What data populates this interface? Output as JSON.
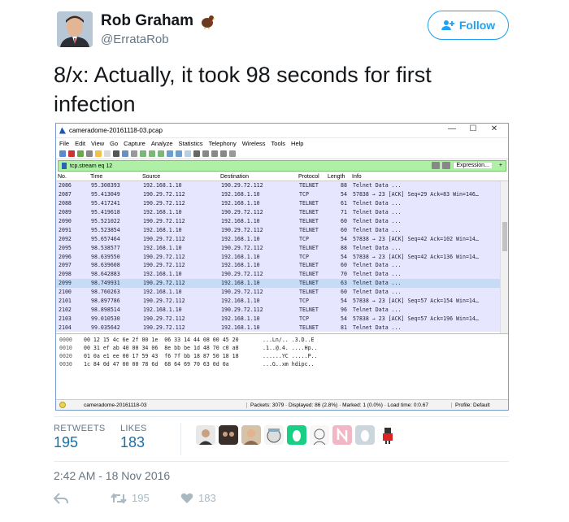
{
  "author": {
    "name": "Rob Graham",
    "handle": "@ErrataRob"
  },
  "follow_button": {
    "label": "Follow"
  },
  "tweet_text": "8/x: Actually, it took 98 seconds for first infection",
  "wireshark": {
    "window_title": "cameradome-20161118-03.pcap",
    "window_controls": [
      "—",
      "☐",
      "✕"
    ],
    "menu": [
      "File",
      "Edit",
      "View",
      "Go",
      "Capture",
      "Analyze",
      "Statistics",
      "Telephony",
      "Wireless",
      "Tools",
      "Help"
    ],
    "filter_value": "tcp.stream eq 12",
    "filter_expression_label": "Expression...",
    "filter_plus": "+",
    "columns": [
      "No.",
      "Time",
      "Source",
      "Destination",
      "Protocol",
      "Length",
      "Info"
    ],
    "rows": [
      {
        "no": "2086",
        "time": "95.308393",
        "src": "192.168.1.10",
        "dst": "190.29.72.112",
        "proto": "TELNET",
        "len": "88",
        "info": "Telnet Data ...",
        "selected": false
      },
      {
        "no": "2087",
        "time": "95.413049",
        "src": "190.29.72.112",
        "dst": "192.168.1.10",
        "proto": "TCP",
        "len": "54",
        "info": "57838 → 23 [ACK] Seq=29 Ack=83 Win=146…",
        "selected": false
      },
      {
        "no": "2088",
        "time": "95.417241",
        "src": "190.29.72.112",
        "dst": "192.168.1.10",
        "proto": "TELNET",
        "len": "61",
        "info": "Telnet Data ...",
        "selected": false
      },
      {
        "no": "2089",
        "time": "95.419618",
        "src": "192.168.1.10",
        "dst": "190.29.72.112",
        "proto": "TELNET",
        "len": "71",
        "info": "Telnet Data ...",
        "selected": false
      },
      {
        "no": "2090",
        "time": "95.521022",
        "src": "190.29.72.112",
        "dst": "192.168.1.10",
        "proto": "TELNET",
        "len": "60",
        "info": "Telnet Data ...",
        "selected": false
      },
      {
        "no": "2091",
        "time": "95.523854",
        "src": "192.168.1.10",
        "dst": "190.29.72.112",
        "proto": "TELNET",
        "len": "60",
        "info": "Telnet Data ...",
        "selected": false
      },
      {
        "no": "2092",
        "time": "95.657464",
        "src": "190.29.72.112",
        "dst": "192.168.1.10",
        "proto": "TCP",
        "len": "54",
        "info": "57838 → 23 [ACK] Seq=42 Ack=102 Win=14…",
        "selected": false
      },
      {
        "no": "2095",
        "time": "98.538577",
        "src": "192.168.1.10",
        "dst": "190.29.72.112",
        "proto": "TELNET",
        "len": "88",
        "info": "Telnet Data ...",
        "selected": false
      },
      {
        "no": "2096",
        "time": "98.639550",
        "src": "190.29.72.112",
        "dst": "192.168.1.10",
        "proto": "TCP",
        "len": "54",
        "info": "57838 → 23 [ACK] Seq=42 Ack=136 Win=14…",
        "selected": false
      },
      {
        "no": "2097",
        "time": "98.639608",
        "src": "190.29.72.112",
        "dst": "192.168.1.10",
        "proto": "TELNET",
        "len": "60",
        "info": "Telnet Data ...",
        "selected": false
      },
      {
        "no": "2098",
        "time": "98.642883",
        "src": "192.168.1.10",
        "dst": "190.29.72.112",
        "proto": "TELNET",
        "len": "70",
        "info": "Telnet Data ...",
        "selected": false
      },
      {
        "no": "2099",
        "time": "98.749931",
        "src": "190.29.72.112",
        "dst": "192.168.1.10",
        "proto": "TELNET",
        "len": "63",
        "info": "Telnet Data ...",
        "selected": true
      },
      {
        "no": "2100",
        "time": "98.760263",
        "src": "192.168.1.10",
        "dst": "190.29.72.112",
        "proto": "TELNET",
        "len": "60",
        "info": "Telnet Data ...",
        "selected": false
      },
      {
        "no": "2101",
        "time": "98.897786",
        "src": "190.29.72.112",
        "dst": "192.168.1.10",
        "proto": "TCP",
        "len": "54",
        "info": "57838 → 23 [ACK] Seq=57 Ack=154 Win=14…",
        "selected": false
      },
      {
        "no": "2102",
        "time": "98.898514",
        "src": "192.168.1.10",
        "dst": "190.29.72.112",
        "proto": "TELNET",
        "len": "96",
        "info": "Telnet Data ...",
        "selected": false
      },
      {
        "no": "2103",
        "time": "99.010530",
        "src": "190.29.72.112",
        "dst": "192.168.1.10",
        "proto": "TCP",
        "len": "54",
        "info": "57838 → 23 [ACK] Seq=57 Ack=196 Win=14…",
        "selected": false
      },
      {
        "no": "2104",
        "time": "99.035642",
        "src": "190.29.72.112",
        "dst": "192.168.1.10",
        "proto": "TELNET",
        "len": "81",
        "info": "Telnet Data ...",
        "selected": false
      }
    ],
    "hex_rows": [
      {
        "offset": "0000",
        "bytes": "00 12 15 4c 6e 2f 00 1e  06 33 14 44 08 00 45 20",
        "ascii": "...Ln/.. .3.D..E "
      },
      {
        "offset": "0010",
        "bytes": "00 31 ef ab 40 00 34 06  8e bb be 1d 48 70 c0 a8",
        "ascii": ".1..@.4. ....Hp.."
      },
      {
        "offset": "0020",
        "bytes": "01 0a e1 ee 00 17 59 43  f6 7f bb 18 87 50 18 18",
        "ascii": "......YC .....P.."
      },
      {
        "offset": "0030",
        "bytes": "1c 84 0d 47 00 00 78 6d  68 64 69 70 63 0d 0a",
        "ascii": "...G..xm hdipc.."
      }
    ],
    "status": {
      "file": "cameradome-20161118-03",
      "stats": "Packets: 3079 · Displayed: 86 (2.8%) · Marked: 1 (0.0%) · Load time: 0:0.67",
      "profile": "Profile: Default"
    }
  },
  "engagement": {
    "retweets_label": "RETWEETS",
    "retweets_value": "195",
    "likes_label": "LIKES",
    "likes_value": "183"
  },
  "timestamp": "2:42 AM - 18 Nov 2016",
  "actions": {
    "retweet_count": "195",
    "like_count": "183"
  },
  "colors": {
    "accent": "#1da1f2",
    "stat_value": "#1b6fa8",
    "muted": "#657786",
    "filter_green": "#aff0a6",
    "packet_row": "#e7e6ff",
    "selected_row": "#c6dbf5"
  }
}
